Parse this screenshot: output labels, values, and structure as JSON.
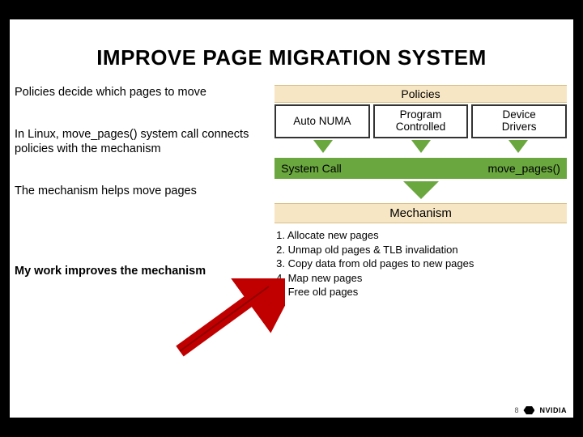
{
  "title": "IMPROVE PAGE MIGRATION SYSTEM",
  "bullets": {
    "b1": "Policies decide which pages to move",
    "b2": "In Linux, move_pages() system call connects policies with the mechanism",
    "b3": "The mechanism helps move pages",
    "b4": "My work improves the mechanism"
  },
  "policies_header": "Policies",
  "policy_boxes": {
    "p1": "Auto NUMA",
    "p2_line1": "Program",
    "p2_line2": "Controlled",
    "p3_line1": "Device",
    "p3_line2": "Drivers"
  },
  "syscall": {
    "left": "System Call",
    "right": "move_pages()"
  },
  "mechanism_header": "Mechanism",
  "mech_steps": {
    "s1": "1. Allocate new pages",
    "s2": "2. Unmap old pages & TLB invalidation",
    "s3": "3. Copy data from old pages to new pages",
    "s4": "4. Map new pages",
    "s5": "5. Free old pages"
  },
  "footer": {
    "page": "8",
    "brand": "NVIDIA"
  }
}
